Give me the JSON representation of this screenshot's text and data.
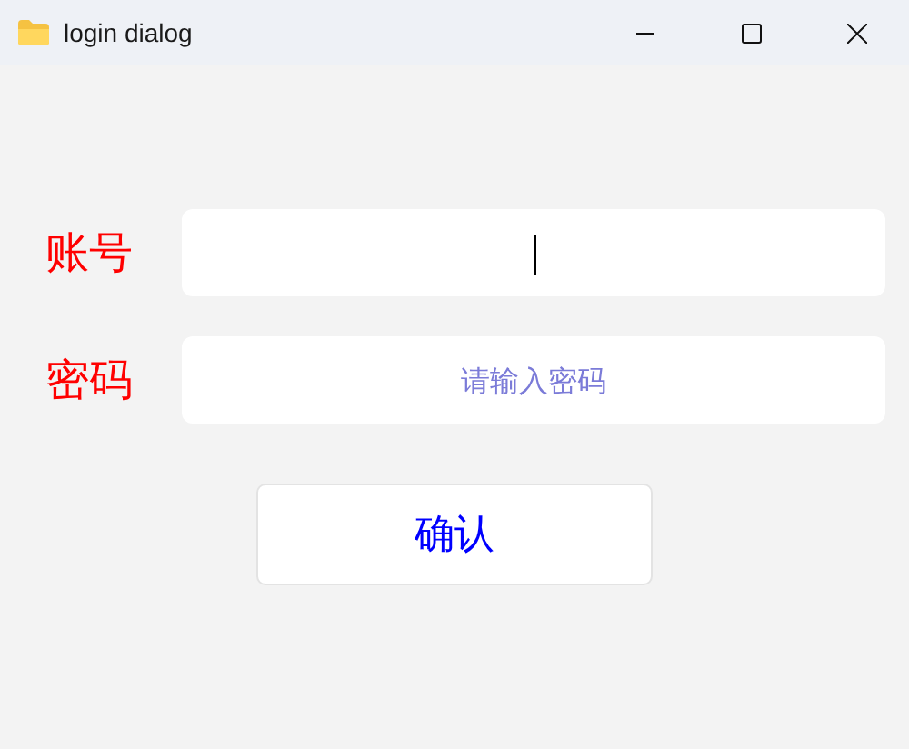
{
  "window": {
    "title": "login dialog"
  },
  "fields": [
    {
      "label": "账号",
      "focused": true
    },
    {
      "label": "密码",
      "placeholder": "请输入密码",
      "focused": false
    }
  ],
  "button": "确认"
}
